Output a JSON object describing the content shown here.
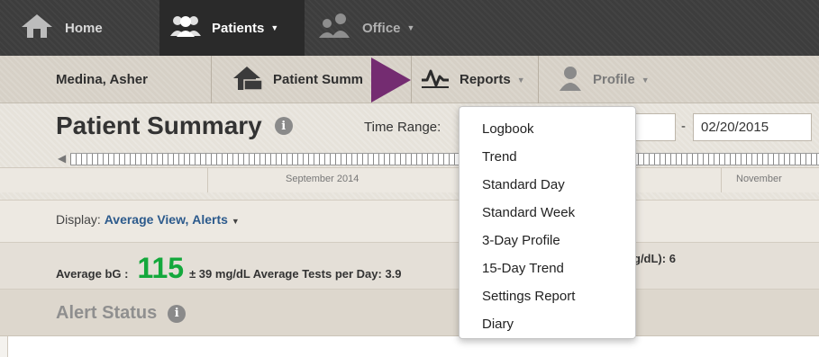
{
  "topnav": {
    "home_label": "Home",
    "patients_label": "Patients",
    "office_label": "Office"
  },
  "subnav": {
    "patient_name": "Medina, Asher",
    "summary_label": "Patient Summ",
    "reports_label": "Reports",
    "profile_label": "Profile"
  },
  "header": {
    "title": "Patient Summary",
    "info_glyph": "i",
    "time_range_label": "Time Range:",
    "start_date_partial": "5",
    "dash": "-",
    "end_date": "02/20/2015"
  },
  "timeline": {
    "months": [
      "September 2014",
      "November"
    ]
  },
  "display": {
    "prefix": "Display:",
    "view": "Average View",
    "comma": ",",
    "alerts": "Alerts"
  },
  "stats": {
    "avg_label": "Average bG :",
    "avg_value": "115",
    "avg_rest": "± 39 mg/dL Average Tests per Day: 3.9",
    "tail": "g/dL): 6"
  },
  "alert_status": {
    "title": "Alert Status"
  },
  "reports_menu": {
    "items": [
      "Logbook",
      "Trend",
      "Standard Day",
      "Standard Week",
      "3-Day Profile",
      "15-Day Trend",
      "Settings Report",
      "Diary"
    ]
  },
  "colors": {
    "accent_green": "#14a83c",
    "link_blue": "#2c5a8c",
    "pointer_purple": "#742c71"
  }
}
